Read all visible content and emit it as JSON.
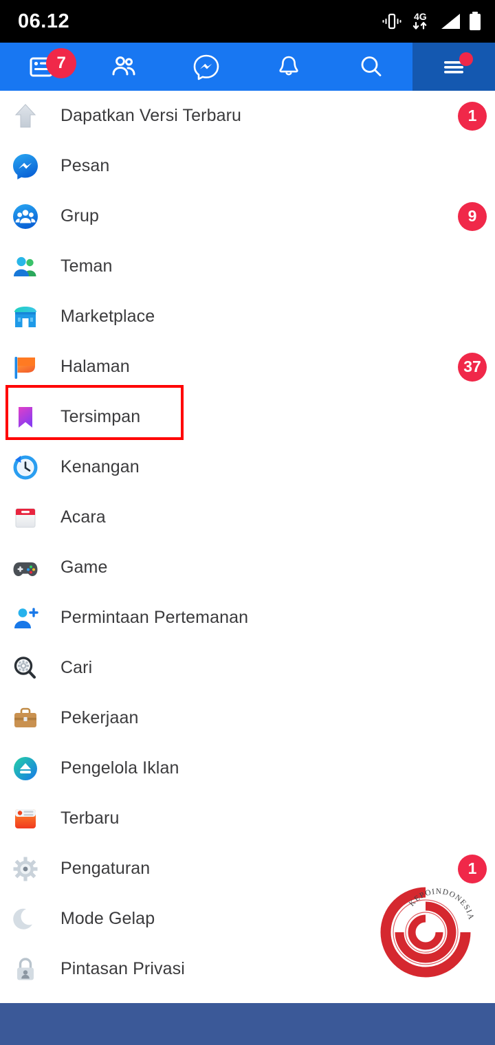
{
  "status_bar": {
    "time": "06.12",
    "network_type": "4G",
    "icons": [
      "vibrate-icon",
      "mobile-data-icon",
      "signal-icon",
      "battery-icon"
    ]
  },
  "colors": {
    "header_blue": "#1877F2",
    "header_active_blue": "#1458b0",
    "badge_red": "#F02849",
    "highlight_red": "#ff0000",
    "bottom_nav_blue": "#3b5998",
    "label_gray": "#3b3b3d"
  },
  "tabbar": {
    "tabs": [
      {
        "name": "news-feed-tab",
        "icon": "news-feed-icon",
        "badge": "7",
        "badge_type": "num",
        "active": false
      },
      {
        "name": "friends-tab",
        "icon": "friends-icon",
        "badge": "",
        "badge_type": "",
        "active": false
      },
      {
        "name": "messenger-tab",
        "icon": "messenger-icon",
        "badge": "",
        "badge_type": "",
        "active": false
      },
      {
        "name": "notifications-tab",
        "icon": "bell-icon",
        "badge": "",
        "badge_type": "",
        "active": false
      },
      {
        "name": "search-tab",
        "icon": "search-icon",
        "badge": "",
        "badge_type": "",
        "active": false
      },
      {
        "name": "menu-tab",
        "icon": "hamburger-menu-icon",
        "badge": "",
        "badge_type": "dot",
        "active": true
      }
    ]
  },
  "menu": {
    "items": [
      {
        "label": "Dapatkan Versi Terbaru",
        "icon": "upgrade-arrow-icon",
        "badge": "1",
        "highlighted": false
      },
      {
        "label": "Pesan",
        "icon": "messenger-icon",
        "badge": "",
        "highlighted": false
      },
      {
        "label": "Grup",
        "icon": "groups-icon",
        "badge": "9",
        "highlighted": false
      },
      {
        "label": "Teman",
        "icon": "friends-color-icon",
        "badge": "",
        "highlighted": false
      },
      {
        "label": "Marketplace",
        "icon": "marketplace-icon",
        "badge": "",
        "highlighted": false
      },
      {
        "label": "Halaman",
        "icon": "pages-flag-icon",
        "badge": "37",
        "highlighted": false
      },
      {
        "label": "Tersimpan",
        "icon": "bookmark-icon",
        "badge": "",
        "highlighted": true
      },
      {
        "label": "Kenangan",
        "icon": "memories-clock-icon",
        "badge": "",
        "highlighted": false
      },
      {
        "label": "Acara",
        "icon": "calendar-icon",
        "badge": "",
        "highlighted": false
      },
      {
        "label": "Game",
        "icon": "gamepad-icon",
        "badge": "",
        "highlighted": false
      },
      {
        "label": "Permintaan Pertemanan",
        "icon": "friend-request-icon",
        "badge": "",
        "highlighted": false
      },
      {
        "label": "Cari",
        "icon": "search-gear-icon",
        "badge": "",
        "highlighted": false
      },
      {
        "label": "Pekerjaan",
        "icon": "briefcase-icon",
        "badge": "",
        "highlighted": false
      },
      {
        "label": "Pengelola Iklan",
        "icon": "ads-manager-icon",
        "badge": "",
        "highlighted": false
      },
      {
        "label": "Terbaru",
        "icon": "recent-news-icon",
        "badge": "",
        "highlighted": false
      },
      {
        "label": "Pengaturan",
        "icon": "gear-icon",
        "badge": "1",
        "highlighted": false
      },
      {
        "label": "Mode Gelap",
        "icon": "moon-icon",
        "badge": "",
        "highlighted": false
      },
      {
        "label": "Pintasan Privasi",
        "icon": "privacy-lock-icon",
        "badge": "",
        "highlighted": false
      }
    ]
  },
  "watermark": {
    "text": "KEPOINDONESIA",
    "color": "#d42027"
  }
}
